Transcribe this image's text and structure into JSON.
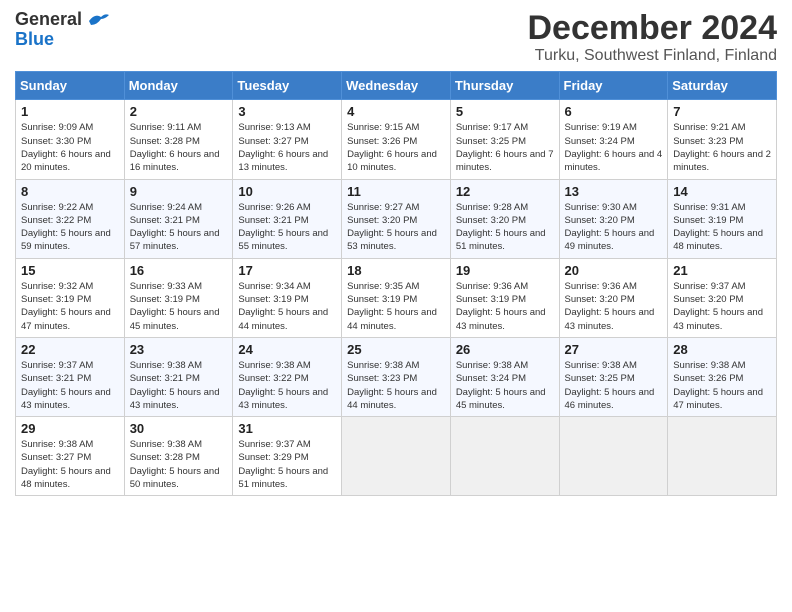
{
  "header": {
    "logo_general": "General",
    "logo_blue": "Blue",
    "title": "December 2024",
    "subtitle": "Turku, Southwest Finland, Finland"
  },
  "calendar": {
    "days_of_week": [
      "Sunday",
      "Monday",
      "Tuesday",
      "Wednesday",
      "Thursday",
      "Friday",
      "Saturday"
    ],
    "weeks": [
      [
        {
          "day": "1",
          "sunrise": "9:09 AM",
          "sunset": "3:30 PM",
          "daylight": "6 hours and 20 minutes."
        },
        {
          "day": "2",
          "sunrise": "9:11 AM",
          "sunset": "3:28 PM",
          "daylight": "6 hours and 16 minutes."
        },
        {
          "day": "3",
          "sunrise": "9:13 AM",
          "sunset": "3:27 PM",
          "daylight": "6 hours and 13 minutes."
        },
        {
          "day": "4",
          "sunrise": "9:15 AM",
          "sunset": "3:26 PM",
          "daylight": "6 hours and 10 minutes."
        },
        {
          "day": "5",
          "sunrise": "9:17 AM",
          "sunset": "3:25 PM",
          "daylight": "6 hours and 7 minutes."
        },
        {
          "day": "6",
          "sunrise": "9:19 AM",
          "sunset": "3:24 PM",
          "daylight": "6 hours and 4 minutes."
        },
        {
          "day": "7",
          "sunrise": "9:21 AM",
          "sunset": "3:23 PM",
          "daylight": "6 hours and 2 minutes."
        }
      ],
      [
        {
          "day": "8",
          "sunrise": "9:22 AM",
          "sunset": "3:22 PM",
          "daylight": "5 hours and 59 minutes."
        },
        {
          "day": "9",
          "sunrise": "9:24 AM",
          "sunset": "3:21 PM",
          "daylight": "5 hours and 57 minutes."
        },
        {
          "day": "10",
          "sunrise": "9:26 AM",
          "sunset": "3:21 PM",
          "daylight": "5 hours and 55 minutes."
        },
        {
          "day": "11",
          "sunrise": "9:27 AM",
          "sunset": "3:20 PM",
          "daylight": "5 hours and 53 minutes."
        },
        {
          "day": "12",
          "sunrise": "9:28 AM",
          "sunset": "3:20 PM",
          "daylight": "5 hours and 51 minutes."
        },
        {
          "day": "13",
          "sunrise": "9:30 AM",
          "sunset": "3:20 PM",
          "daylight": "5 hours and 49 minutes."
        },
        {
          "day": "14",
          "sunrise": "9:31 AM",
          "sunset": "3:19 PM",
          "daylight": "5 hours and 48 minutes."
        }
      ],
      [
        {
          "day": "15",
          "sunrise": "9:32 AM",
          "sunset": "3:19 PM",
          "daylight": "5 hours and 47 minutes."
        },
        {
          "day": "16",
          "sunrise": "9:33 AM",
          "sunset": "3:19 PM",
          "daylight": "5 hours and 45 minutes."
        },
        {
          "day": "17",
          "sunrise": "9:34 AM",
          "sunset": "3:19 PM",
          "daylight": "5 hours and 44 minutes."
        },
        {
          "day": "18",
          "sunrise": "9:35 AM",
          "sunset": "3:19 PM",
          "daylight": "5 hours and 44 minutes."
        },
        {
          "day": "19",
          "sunrise": "9:36 AM",
          "sunset": "3:19 PM",
          "daylight": "5 hours and 43 minutes."
        },
        {
          "day": "20",
          "sunrise": "9:36 AM",
          "sunset": "3:20 PM",
          "daylight": "5 hours and 43 minutes."
        },
        {
          "day": "21",
          "sunrise": "9:37 AM",
          "sunset": "3:20 PM",
          "daylight": "5 hours and 43 minutes."
        }
      ],
      [
        {
          "day": "22",
          "sunrise": "9:37 AM",
          "sunset": "3:21 PM",
          "daylight": "5 hours and 43 minutes."
        },
        {
          "day": "23",
          "sunrise": "9:38 AM",
          "sunset": "3:21 PM",
          "daylight": "5 hours and 43 minutes."
        },
        {
          "day": "24",
          "sunrise": "9:38 AM",
          "sunset": "3:22 PM",
          "daylight": "5 hours and 43 minutes."
        },
        {
          "day": "25",
          "sunrise": "9:38 AM",
          "sunset": "3:23 PM",
          "daylight": "5 hours and 44 minutes."
        },
        {
          "day": "26",
          "sunrise": "9:38 AM",
          "sunset": "3:24 PM",
          "daylight": "5 hours and 45 minutes."
        },
        {
          "day": "27",
          "sunrise": "9:38 AM",
          "sunset": "3:25 PM",
          "daylight": "5 hours and 46 minutes."
        },
        {
          "day": "28",
          "sunrise": "9:38 AM",
          "sunset": "3:26 PM",
          "daylight": "5 hours and 47 minutes."
        }
      ],
      [
        {
          "day": "29",
          "sunrise": "9:38 AM",
          "sunset": "3:27 PM",
          "daylight": "5 hours and 48 minutes."
        },
        {
          "day": "30",
          "sunrise": "9:38 AM",
          "sunset": "3:28 PM",
          "daylight": "5 hours and 50 minutes."
        },
        {
          "day": "31",
          "sunrise": "9:37 AM",
          "sunset": "3:29 PM",
          "daylight": "5 hours and 51 minutes."
        },
        null,
        null,
        null,
        null
      ]
    ]
  }
}
